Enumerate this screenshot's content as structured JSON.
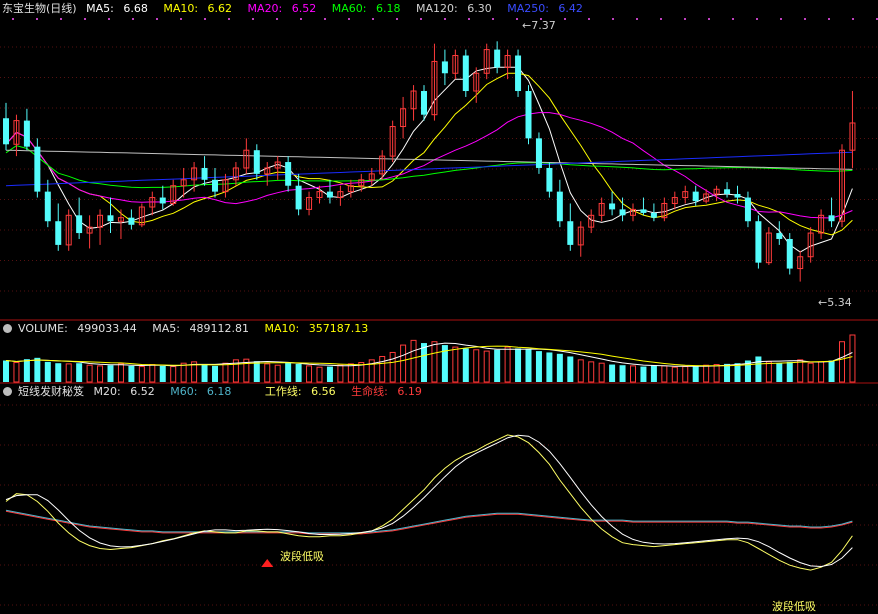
{
  "price_panel": {
    "stock_title": "东宝生物(日线)",
    "ma5_label": "MA5:",
    "ma5_value": "6.68",
    "ma10_label": "MA10:",
    "ma10_value": "6.62",
    "ma20_label": "MA20:",
    "ma20_value": "6.52",
    "ma60_label": "MA60:",
    "ma60_value": "6.18",
    "ma120_label": "MA120:",
    "ma120_value": "6.30",
    "ma250_label": "MA250:",
    "ma250_value": "6.42",
    "high_marker": "7.37",
    "low_marker": "5.34"
  },
  "volume_panel": {
    "volume_label": "VOLUME:",
    "volume_value": "499033.44",
    "ma5_label": "MA5:",
    "ma5_value": "489112.81",
    "ma10_label": "MA10:",
    "ma10_value": "357187.13"
  },
  "indicator_panel": {
    "name": "短线发财秘笈",
    "m20_label": "M20:",
    "m20_value": "6.52",
    "m60_label": "M60:",
    "m60_value": "6.18",
    "work_label": "工作线:",
    "work_value": "6.56",
    "life_label": "生命线:",
    "life_value": "6.19",
    "signal_1": "波段低吸",
    "signal_2": "波段低吸"
  },
  "colors": {
    "up": "#ff3b3b",
    "down": "#54fcfc",
    "ma5": "#ffffff",
    "ma10": "#ffff00",
    "ma20": "#ff00ff",
    "ma60": "#00ff00",
    "ma120": "#c0c0c0",
    "ma250": "#1a2cff",
    "work_line": "#ffff66",
    "life_line": "#ff3b3b"
  },
  "chart_data": {
    "type": "candlestick",
    "price_range": [
      5.1,
      7.55
    ],
    "high": 7.37,
    "low": 5.34,
    "ohlc": [
      [
        6.72,
        6.85,
        6.45,
        6.5
      ],
      [
        6.5,
        6.75,
        6.4,
        6.7
      ],
      [
        6.7,
        6.8,
        6.45,
        6.48
      ],
      [
        6.48,
        6.55,
        6.05,
        6.1
      ],
      [
        6.1,
        6.2,
        5.8,
        5.85
      ],
      [
        5.85,
        6.0,
        5.6,
        5.65
      ],
      [
        5.65,
        5.95,
        5.6,
        5.9
      ],
      [
        5.9,
        6.05,
        5.7,
        5.75
      ],
      [
        5.75,
        5.9,
        5.62,
        5.8
      ],
      [
        5.8,
        5.95,
        5.65,
        5.9
      ],
      [
        5.9,
        6.05,
        5.75,
        5.85
      ],
      [
        5.85,
        5.95,
        5.7,
        5.88
      ],
      [
        5.88,
        5.95,
        5.78,
        5.82
      ],
      [
        5.82,
        6.0,
        5.8,
        5.97
      ],
      [
        5.97,
        6.1,
        5.9,
        6.05
      ],
      [
        6.05,
        6.15,
        5.95,
        6.0
      ],
      [
        6.0,
        6.2,
        5.98,
        6.15
      ],
      [
        6.15,
        6.3,
        6.05,
        6.2
      ],
      [
        6.2,
        6.35,
        6.1,
        6.3
      ],
      [
        6.3,
        6.4,
        6.15,
        6.2
      ],
      [
        6.2,
        6.3,
        6.05,
        6.1
      ],
      [
        6.1,
        6.25,
        6.05,
        6.2
      ],
      [
        6.2,
        6.35,
        6.15,
        6.3
      ],
      [
        6.3,
        6.55,
        6.25,
        6.45
      ],
      [
        6.45,
        6.5,
        6.2,
        6.25
      ],
      [
        6.25,
        6.35,
        6.15,
        6.3
      ],
      [
        6.3,
        6.4,
        6.2,
        6.35
      ],
      [
        6.35,
        6.4,
        6.1,
        6.15
      ],
      [
        6.15,
        6.25,
        5.9,
        5.95
      ],
      [
        5.95,
        6.1,
        5.9,
        6.05
      ],
      [
        6.05,
        6.15,
        6.0,
        6.1
      ],
      [
        6.1,
        6.2,
        6.0,
        6.05
      ],
      [
        6.05,
        6.15,
        5.98,
        6.1
      ],
      [
        6.1,
        6.2,
        6.05,
        6.15
      ],
      [
        6.15,
        6.25,
        6.1,
        6.2
      ],
      [
        6.2,
        6.3,
        6.15,
        6.25
      ],
      [
        6.25,
        6.45,
        6.2,
        6.4
      ],
      [
        6.4,
        6.7,
        6.35,
        6.65
      ],
      [
        6.65,
        6.9,
        6.55,
        6.8
      ],
      [
        6.8,
        7.0,
        6.7,
        6.95
      ],
      [
        6.95,
        7.0,
        6.7,
        6.75
      ],
      [
        6.75,
        7.35,
        6.7,
        7.2
      ],
      [
        7.2,
        7.3,
        7.0,
        7.1
      ],
      [
        7.1,
        7.3,
        7.05,
        7.25
      ],
      [
        7.25,
        7.3,
        6.9,
        6.95
      ],
      [
        6.95,
        7.15,
        6.85,
        7.1
      ],
      [
        7.1,
        7.35,
        7.05,
        7.3
      ],
      [
        7.3,
        7.37,
        7.1,
        7.15
      ],
      [
        7.15,
        7.3,
        7.05,
        7.25
      ],
      [
        7.25,
        7.3,
        6.9,
        6.95
      ],
      [
        6.95,
        7.0,
        6.5,
        6.55
      ],
      [
        6.55,
        6.6,
        6.25,
        6.3
      ],
      [
        6.3,
        6.35,
        6.05,
        6.1
      ],
      [
        6.1,
        6.2,
        5.8,
        5.85
      ],
      [
        5.85,
        6.0,
        5.6,
        5.65
      ],
      [
        5.65,
        5.85,
        5.55,
        5.8
      ],
      [
        5.8,
        5.95,
        5.75,
        5.9
      ],
      [
        5.9,
        6.05,
        5.85,
        6.0
      ],
      [
        6.0,
        6.1,
        5.9,
        5.95
      ],
      [
        5.95,
        6.05,
        5.85,
        5.9
      ],
      [
        5.9,
        6.0,
        5.85,
        5.95
      ],
      [
        5.95,
        6.05,
        5.9,
        5.92
      ],
      [
        5.92,
        6.0,
        5.85,
        5.88
      ],
      [
        5.88,
        6.05,
        5.85,
        6.0
      ],
      [
        6.0,
        6.1,
        5.95,
        6.05
      ],
      [
        6.05,
        6.15,
        6.0,
        6.1
      ],
      [
        6.1,
        6.15,
        5.98,
        6.02
      ],
      [
        6.02,
        6.12,
        6.0,
        6.08
      ],
      [
        6.08,
        6.15,
        6.02,
        6.12
      ],
      [
        6.12,
        6.18,
        6.05,
        6.08
      ],
      [
        6.08,
        6.15,
        6.0,
        6.05
      ],
      [
        6.05,
        6.1,
        5.8,
        5.85
      ],
      [
        5.85,
        5.9,
        5.45,
        5.5
      ],
      [
        5.5,
        5.8,
        5.48,
        5.75
      ],
      [
        5.75,
        5.85,
        5.65,
        5.7
      ],
      [
        5.7,
        5.75,
        5.4,
        5.45
      ],
      [
        5.45,
        5.6,
        5.34,
        5.55
      ],
      [
        5.55,
        5.8,
        5.5,
        5.75
      ],
      [
        5.75,
        5.95,
        5.7,
        5.9
      ],
      [
        5.9,
        6.05,
        5.8,
        5.85
      ],
      [
        5.85,
        6.5,
        5.8,
        6.45
      ],
      [
        6.45,
        6.95,
        6.3,
        6.68
      ]
    ],
    "volume": [
      32,
      29,
      34,
      36,
      30,
      28,
      27,
      28,
      25,
      24,
      25,
      27,
      24,
      23,
      26,
      24,
      23,
      28,
      30,
      26,
      24,
      28,
      33,
      34,
      31,
      27,
      25,
      29,
      27,
      24,
      22,
      23,
      25,
      27,
      29,
      33,
      38,
      44,
      55,
      62,
      58,
      60,
      55,
      52,
      50,
      48,
      46,
      48,
      52,
      50,
      49,
      46,
      44,
      42,
      38,
      33,
      30,
      28,
      26,
      25,
      24,
      23,
      25,
      24,
      22,
      23,
      24,
      25,
      26,
      27,
      28,
      32,
      38,
      30,
      28,
      30,
      33,
      28,
      30,
      32,
      60,
      70
    ],
    "indicator_work": [
      6.4,
      6.48,
      6.47,
      6.4,
      6.3,
      6.18,
      6.08,
      6.0,
      5.95,
      5.92,
      5.91,
      5.92,
      5.93,
      5.95,
      5.97,
      6.0,
      6.02,
      6.05,
      6.08,
      6.1,
      6.09,
      6.08,
      6.08,
      6.1,
      6.1,
      6.09,
      6.09,
      6.07,
      6.05,
      6.04,
      6.04,
      6.05,
      6.05,
      6.06,
      6.08,
      6.1,
      6.15,
      6.22,
      6.32,
      6.42,
      6.52,
      6.64,
      6.74,
      6.82,
      6.88,
      6.92,
      6.98,
      7.03,
      7.08,
      7.06,
      7.0,
      6.9,
      6.78,
      6.62,
      6.48,
      6.34,
      6.22,
      6.12,
      6.04,
      5.98,
      5.96,
      5.95,
      5.94,
      5.95,
      5.96,
      5.97,
      5.98,
      5.99,
      6.0,
      6.01,
      6.01,
      5.98,
      5.92,
      5.86,
      5.8,
      5.75,
      5.72,
      5.7,
      5.73,
      5.78,
      5.9,
      6.05
    ],
    "indicator_life": [
      6.3,
      6.28,
      6.26,
      6.24,
      6.22,
      6.2,
      6.18,
      6.16,
      6.14,
      6.13,
      6.12,
      6.11,
      6.1,
      6.09,
      6.09,
      6.08,
      6.08,
      6.08,
      6.08,
      6.08,
      6.08,
      6.08,
      6.08,
      6.08,
      6.08,
      6.08,
      6.08,
      6.08,
      6.08,
      6.07,
      6.07,
      6.07,
      6.07,
      6.07,
      6.07,
      6.08,
      6.09,
      6.1,
      6.12,
      6.14,
      6.16,
      6.18,
      6.2,
      6.22,
      6.24,
      6.25,
      6.26,
      6.27,
      6.27,
      6.27,
      6.26,
      6.25,
      6.24,
      6.23,
      6.22,
      6.21,
      6.2,
      6.2,
      6.2,
      6.2,
      6.19,
      6.19,
      6.19,
      6.19,
      6.19,
      6.19,
      6.19,
      6.19,
      6.19,
      6.19,
      6.18,
      6.18,
      6.17,
      6.16,
      6.15,
      6.14,
      6.14,
      6.13,
      6.13,
      6.14,
      6.16,
      6.19
    ],
    "signals": [
      {
        "index": 25,
        "text": "波段低吸"
      },
      {
        "index": 76,
        "text": "波段低吸"
      }
    ]
  }
}
